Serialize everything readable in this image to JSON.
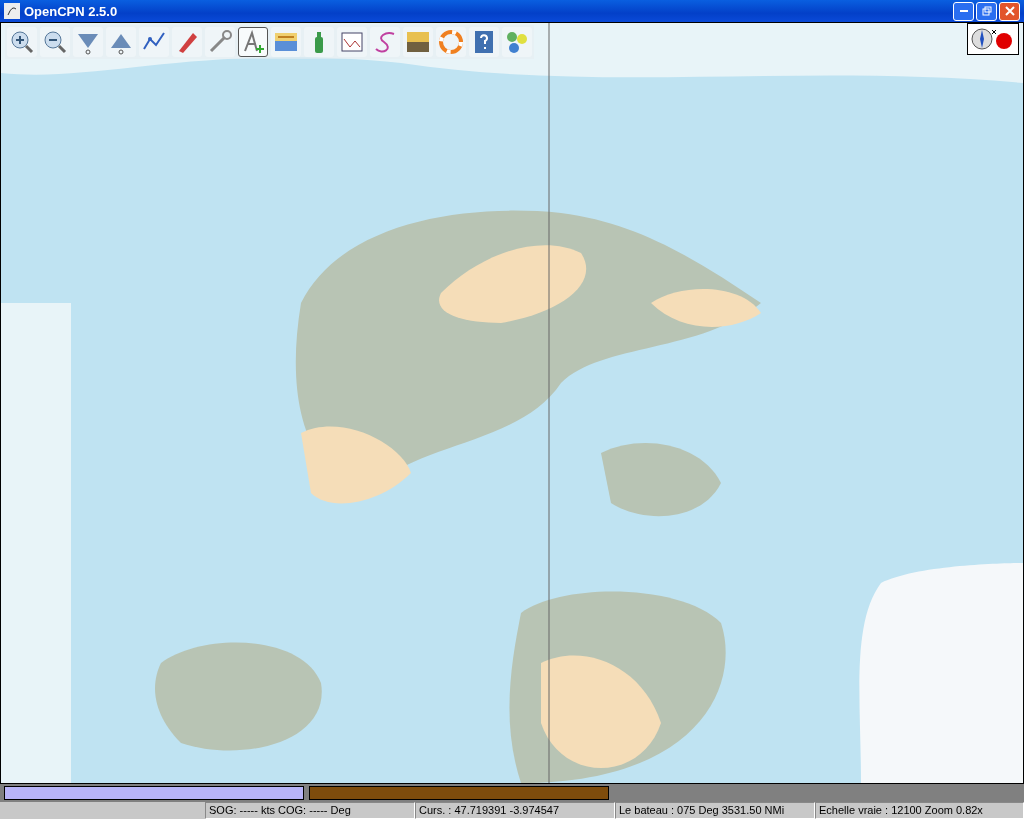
{
  "window": {
    "title": "OpenCPN 2.5.0"
  },
  "toolbar": [
    {
      "kind": "zoom-in",
      "selected": false
    },
    {
      "kind": "zoom-out",
      "selected": false
    },
    {
      "kind": "scale-down",
      "selected": false
    },
    {
      "kind": "scale-up",
      "selected": false
    },
    {
      "kind": "route",
      "selected": false
    },
    {
      "kind": "ship",
      "selected": false
    },
    {
      "kind": "tools",
      "selected": false
    },
    {
      "kind": "text",
      "selected": true
    },
    {
      "kind": "chart",
      "selected": false
    },
    {
      "kind": "bottle",
      "selected": false
    },
    {
      "kind": "graph",
      "selected": false
    },
    {
      "kind": "track",
      "selected": false
    },
    {
      "kind": "color",
      "selected": false
    },
    {
      "kind": "lifebuoy",
      "selected": false
    },
    {
      "kind": "help",
      "selected": false
    },
    {
      "kind": "settings",
      "selected": false
    }
  ],
  "piano": [
    {
      "color": "#b8b4f8"
    },
    {
      "color": "#7e4c0c"
    }
  ],
  "status_bar": [
    "SOG: ----- kts  COG: ----- Deg",
    "Curs. : 47.719391 -3.974547",
    "Le  bateau : 075 Deg  3531.50 NMi",
    "Echelle vraie :     12100  Zoom 0.82x"
  ]
}
